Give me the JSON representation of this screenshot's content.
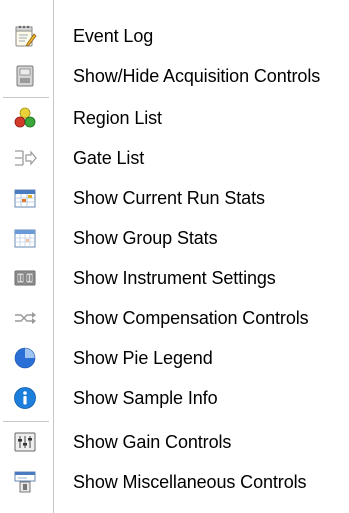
{
  "menu": {
    "items": [
      {
        "label": "Event Log",
        "icon": "notepad-icon"
      },
      {
        "label": "Show/Hide Acquisition Controls",
        "icon": "acquisition-device-icon"
      },
      {
        "label": "Region List",
        "icon": "region-circles-icon"
      },
      {
        "label": "Gate List",
        "icon": "gate-icon"
      },
      {
        "label": "Show Current Run Stats",
        "icon": "run-stats-calendar-icon"
      },
      {
        "label": "Show Group Stats",
        "icon": "group-stats-grid-icon"
      },
      {
        "label": "Show Instrument Settings",
        "icon": "instrument-settings-icon"
      },
      {
        "label": "Show Compensation Controls",
        "icon": "compensation-arrows-icon"
      },
      {
        "label": "Show Pie Legend",
        "icon": "pie-chart-icon"
      },
      {
        "label": "Show Sample Info",
        "icon": "info-icon"
      },
      {
        "label": "Show Gain Controls",
        "icon": "sliders-icon"
      },
      {
        "label": "Show Miscellaneous Controls",
        "icon": "misc-controls-icon"
      }
    ]
  },
  "colors": {
    "separator": "#c8c8c8",
    "pie_blue": "#2a6fd6",
    "info_blue": "#1c7fdc"
  }
}
